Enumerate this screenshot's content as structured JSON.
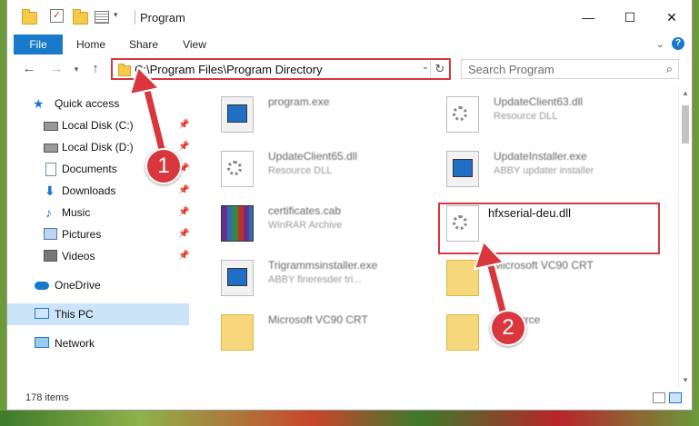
{
  "window": {
    "title": "Program"
  },
  "ribbon": {
    "tabs": [
      {
        "label": "File"
      },
      {
        "label": "Home"
      },
      {
        "label": "Share"
      },
      {
        "label": "View"
      }
    ]
  },
  "nav": {
    "address": "C:\\Program Files\\Program Directory",
    "search_placeholder": "Search Program"
  },
  "sidebar": {
    "items": [
      {
        "label": "Quick access",
        "icon": "star-icon"
      },
      {
        "label": "Local Disk (C:)",
        "icon": "drive-icon",
        "pinned": true
      },
      {
        "label": "Local Disk (D:)",
        "icon": "drive-icon",
        "pinned": true
      },
      {
        "label": "Documents",
        "icon": "documents-icon",
        "pinned": true
      },
      {
        "label": "Downloads",
        "icon": "downloads-icon",
        "pinned": true
      },
      {
        "label": "Music",
        "icon": "music-icon",
        "pinned": true
      },
      {
        "label": "Pictures",
        "icon": "pictures-icon",
        "pinned": true
      },
      {
        "label": "Videos",
        "icon": "videos-icon",
        "pinned": true
      },
      {
        "label": "OneDrive",
        "icon": "onedrive-icon"
      },
      {
        "label": "This PC",
        "icon": "this-pc-icon",
        "selected": true
      },
      {
        "label": "Network",
        "icon": "network-icon"
      }
    ]
  },
  "files": [
    {
      "name": "program.exe",
      "type": "",
      "icon": "exe-icon"
    },
    {
      "name": "UpdateClient63.dll",
      "type": "Resource DLL",
      "icon": "dll-icon"
    },
    {
      "name": "UpdateClient65.dll",
      "type": "Resource DLL",
      "icon": "dll-icon"
    },
    {
      "name": "UpdateInstaller.exe",
      "type": "ABBY updater installer",
      "icon": "exe-icon"
    },
    {
      "name": "certificates.cab",
      "type": "WinRAR Archive",
      "icon": "archive-icon"
    },
    {
      "name": "hfxserial-deu.dll",
      "type": "",
      "icon": "dll-icon"
    },
    {
      "name": "Trigrammsinstaller.exe",
      "type": "ABBY fineresder tri...",
      "icon": "exe-icon"
    },
    {
      "name": "Microsoft VC90 CRT",
      "type": "",
      "icon": "folder-icon"
    },
    {
      "name": "Microsoft VC90 CRT",
      "type": "",
      "icon": "folder-icon"
    },
    {
      "name": "Resource",
      "type": "",
      "icon": "folder-icon"
    }
  ],
  "annotations": {
    "step1": "1",
    "step2": "2"
  },
  "status": {
    "item_count": "178 items"
  },
  "colors": {
    "accent": "#1979ca",
    "highlight": "#d9363e",
    "selected": "#cce4f7"
  }
}
